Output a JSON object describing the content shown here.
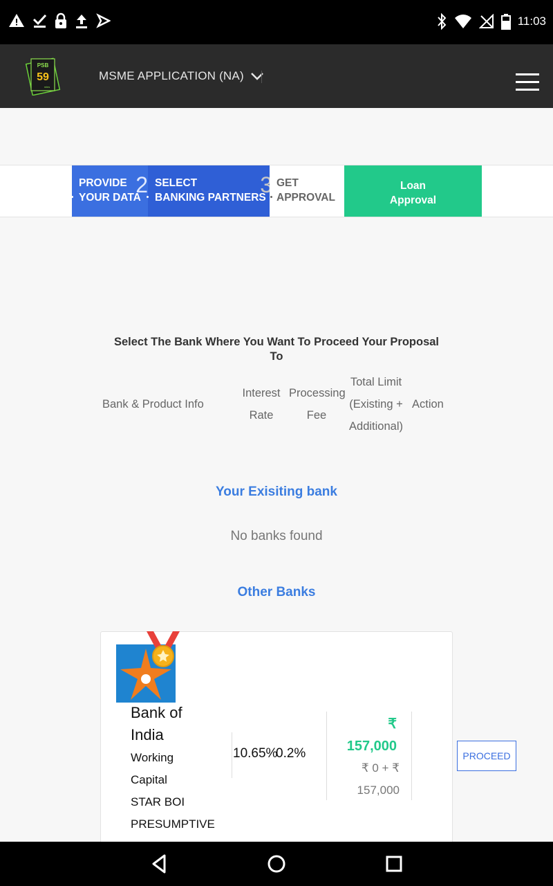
{
  "status_bar": {
    "time": "11:03",
    "left_icons": [
      "warning-icon",
      "download-done-icon",
      "lock-icon",
      "upload-icon",
      "send-icon"
    ],
    "right_icons": [
      "bluetooth-icon",
      "wifi-icon",
      "no-signal-icon",
      "battery-icon"
    ]
  },
  "header": {
    "app_title": "MSME APPLICATION (NA)",
    "logo": {
      "top": "PSB",
      "number": "59",
      "bottom": "mins"
    }
  },
  "stepper": {
    "step1_label_line1": "PROVIDE",
    "step1_label_line2": "YOUR DATA",
    "step2_number": "2",
    "step2_label_line1": "SELECT",
    "step2_label_line2": "BANKING PARTNERS",
    "step3_number": "3",
    "step3_label_line1": "GET",
    "step3_label_line2": "APPROVAL",
    "step4_label_line1": "Loan",
    "step4_label_line2": "Approval"
  },
  "main": {
    "heading_line1": "Select The Bank Where You Want To Proceed Your Proposal",
    "heading_line2": "To",
    "columns": {
      "bank_info": "Bank & Product Info",
      "interest_line1": "Interest",
      "interest_line2": "Rate",
      "fee_line1": "Processing",
      "fee_line2": "Fee",
      "limit_line1": "Total Limit",
      "limit_line2": "(Existing +",
      "limit_line3": "Additional)",
      "action": "Action"
    },
    "existing_bank_title": "Your Exisiting bank",
    "no_banks_text": "No banks found",
    "other_banks_title": "Other Banks"
  },
  "bank_card": {
    "bank_name_line1": "Bank of",
    "bank_name_line2": "India",
    "product_line1": "Working",
    "product_line2": "Capital",
    "product_line3": "STAR BOI",
    "product_line4": "PRESUMPTIVE",
    "interest_rate": "10.65%",
    "processing_fee": "0.2%",
    "limit_currency": "₹",
    "limit_total": "157,000",
    "limit_breakdown_line1": "₹ 0 + ₹",
    "limit_breakdown_line2": "157,000",
    "action_label": "PROCEED"
  },
  "colors": {
    "header_bg": "#2b2b2b",
    "step_active": "#3b6fe0",
    "step_success": "#22c98a",
    "accent_blue": "#3b7de0"
  }
}
